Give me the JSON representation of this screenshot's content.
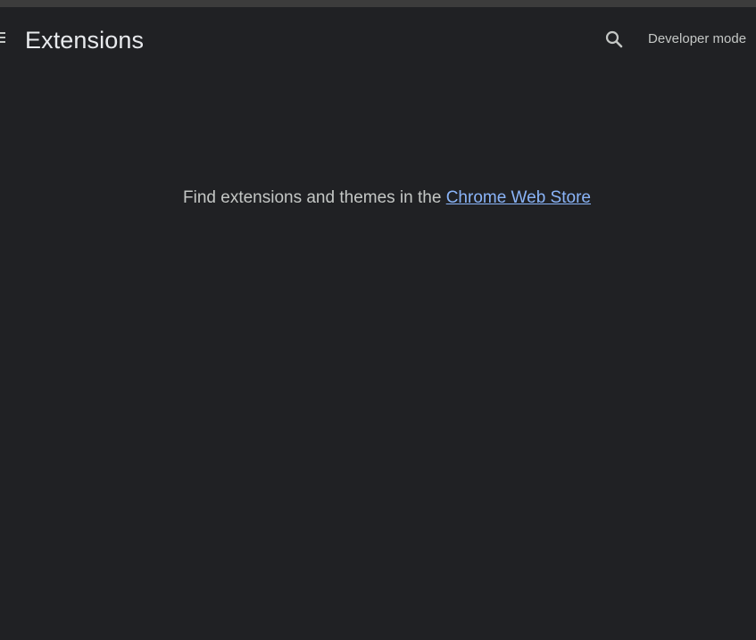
{
  "header": {
    "title": "Extensions",
    "menu_icon": "hamburger-menu-icon",
    "search_icon": "search-icon",
    "developer_mode_label": "Developer mode"
  },
  "empty_state": {
    "message_prefix": "Find extensions and themes in the ",
    "link_text": "Chrome Web Store"
  },
  "colors": {
    "background": "#202124",
    "text": "#e8eaed",
    "link": "#8ab4f8"
  }
}
